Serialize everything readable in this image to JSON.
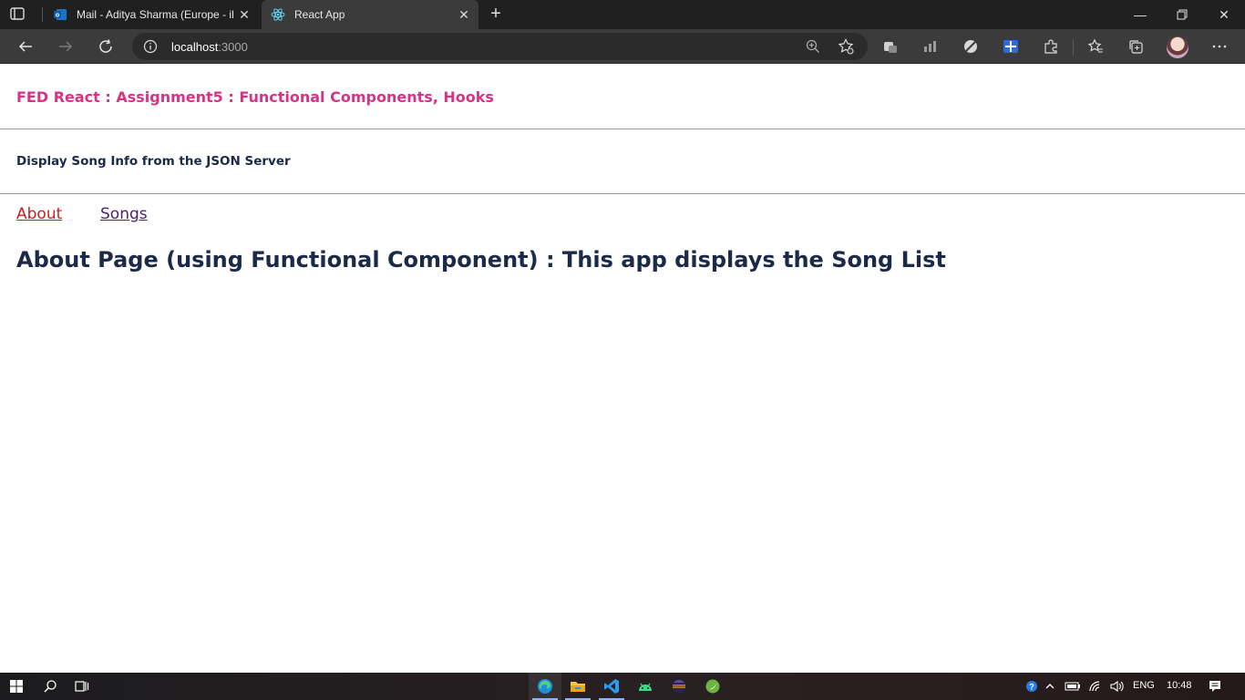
{
  "browser": {
    "tabs": [
      {
        "title": "Mail - Aditya Sharma (Europe - il",
        "icon": "outlook-icon",
        "active": false
      },
      {
        "title": "React App",
        "icon": "react-icon",
        "active": true
      }
    ],
    "address": {
      "host": "localhost",
      "port": ":3000"
    }
  },
  "page": {
    "app_title": "FED React : Assignment5 : Functional Components, Hooks",
    "subtitle": "Display Song Info from the JSON Server",
    "nav": {
      "about": "About",
      "songs": "Songs"
    },
    "heading": "About Page (using Functional Component) : This app displays the Song List"
  },
  "taskbar": {
    "language": "ENG",
    "time": "10:48",
    "apps": [
      "edge-icon",
      "file-explorer-icon",
      "vscode-icon",
      "android-studio-icon",
      "eclipse-icon",
      "spring-icon"
    ]
  },
  "colors": {
    "app_title": "#d63384",
    "heading": "#1b2a49",
    "link_active": "#cc1b1b",
    "link_visited": "#4b2173"
  }
}
